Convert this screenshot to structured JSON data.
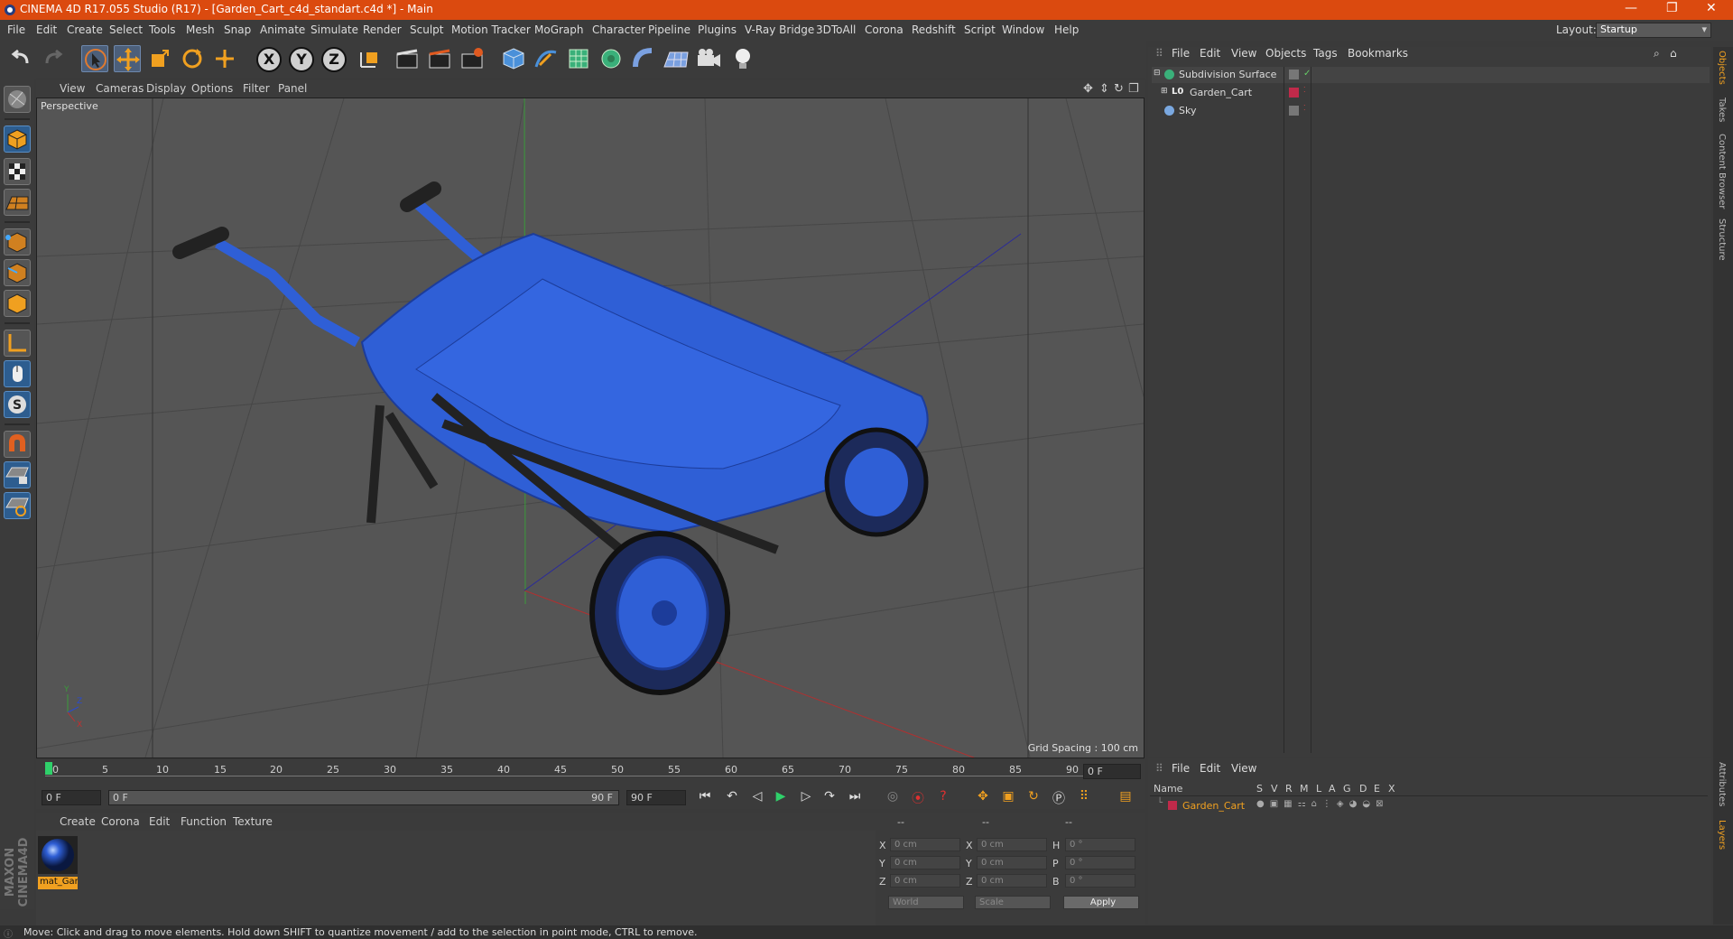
{
  "app": {
    "title": "CINEMA 4D R17.055 Studio (R17) - [Garden_Cart_c4d_standart.c4d *] - Main",
    "layout_label": "Layout:",
    "layout_value": "Startup"
  },
  "menubar": [
    "File",
    "Edit",
    "Create",
    "Select",
    "Tools",
    "Mesh",
    "Snap",
    "Animate",
    "Simulate",
    "Render",
    "Sculpt",
    "Motion Tracker",
    "MoGraph",
    "Character",
    "Pipeline",
    "Plugins",
    "V-Ray Bridge",
    "3DToAll",
    "Corona",
    "Redshift",
    "Script",
    "Window",
    "Help"
  ],
  "toolbar": {
    "axis_x": "X",
    "axis_y": "Y",
    "axis_z": "Z"
  },
  "viewport": {
    "menu": [
      "View",
      "Cameras",
      "Display",
      "Options",
      "Filter",
      "Panel"
    ],
    "label": "Perspective",
    "grid_spacing": "Grid Spacing : 100 cm",
    "accent": "#2f5fd6"
  },
  "timeline": {
    "ticks": [
      "0",
      "5",
      "10",
      "15",
      "20",
      "25",
      "30",
      "35",
      "40",
      "45",
      "50",
      "55",
      "60",
      "65",
      "70",
      "75",
      "80",
      "85",
      "90"
    ],
    "frame_field": "0 F",
    "start_field": "0 F",
    "range_start": "0 F",
    "range_end": "90 F",
    "end_field": "90 F"
  },
  "material_panel": {
    "menu": [
      "Create",
      "Corona",
      "Edit",
      "Function",
      "Texture"
    ],
    "material_name": "mat_Gar"
  },
  "coords": {
    "header": [
      "--",
      "--",
      "--"
    ],
    "rows": [
      {
        "a": "X",
        "av": "0 cm",
        "b": "X",
        "bv": "0 cm",
        "c": "H",
        "cv": "0 °"
      },
      {
        "a": "Y",
        "av": "0 cm",
        "b": "Y",
        "bv": "0 cm",
        "c": "P",
        "cv": "0 °"
      },
      {
        "a": "Z",
        "av": "0 cm",
        "b": "Z",
        "bv": "0 cm",
        "c": "B",
        "cv": "0 °"
      }
    ],
    "world": "World",
    "scale": "Scale",
    "apply": "Apply"
  },
  "objects_panel": {
    "menu": [
      "File",
      "Edit",
      "View",
      "Objects",
      "Tags",
      "Bookmarks"
    ],
    "items": [
      {
        "name": "Subdivision Surface"
      },
      {
        "name": "Garden_Cart"
      },
      {
        "name": "Sky"
      }
    ]
  },
  "layers_panel": {
    "menu": [
      "File",
      "Edit",
      "View"
    ],
    "columns": [
      "Name",
      "S",
      "V",
      "R",
      "M",
      "L",
      "A",
      "G",
      "D",
      "E",
      "X"
    ],
    "items": [
      {
        "name": "Garden_Cart"
      }
    ]
  },
  "right_tabs": [
    "Objects",
    "Takes",
    "Content Browser",
    "Structure",
    "Attributes",
    "Layers"
  ],
  "branding": "MAXON CINEMA4D",
  "status": "Move: Click and drag to move elements. Hold down SHIFT to quantize movement / add to the selection in point mode, CTRL to remove."
}
